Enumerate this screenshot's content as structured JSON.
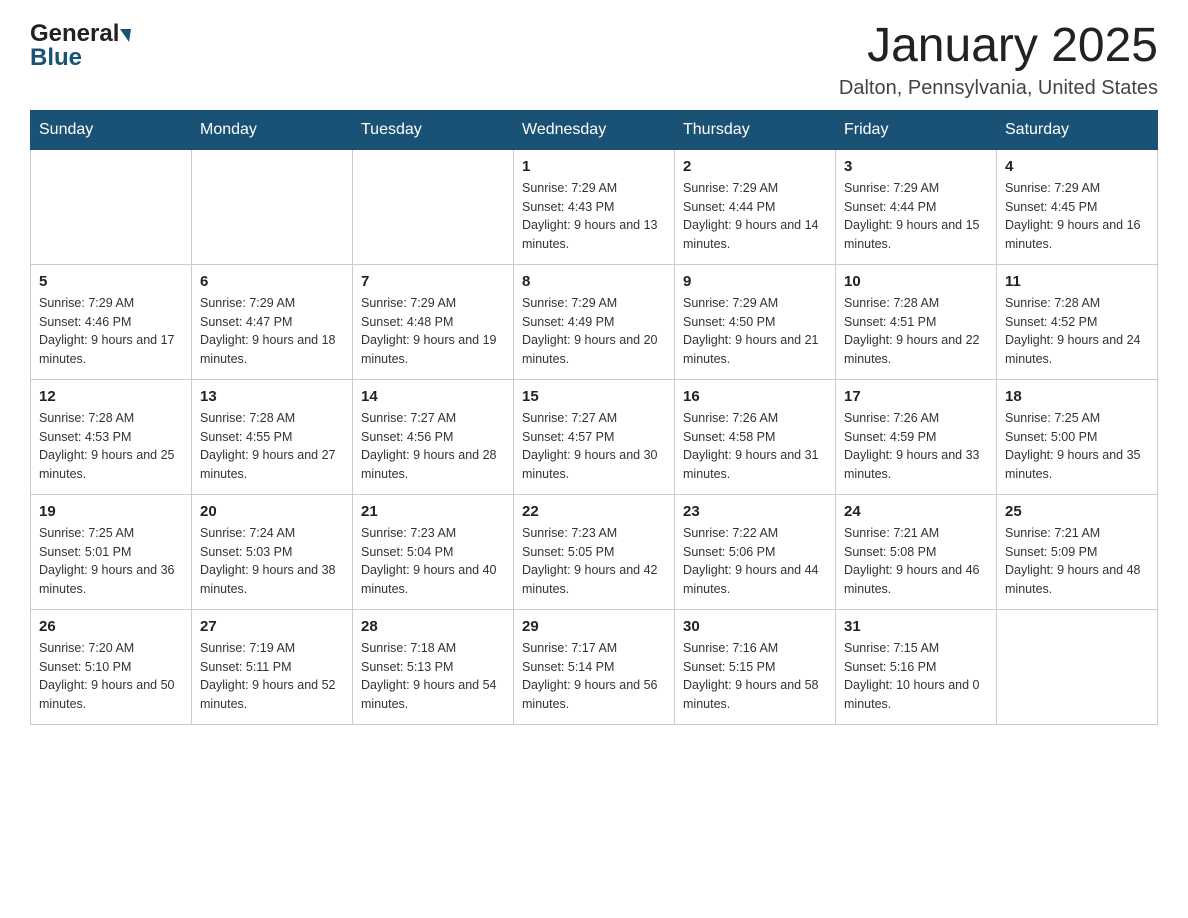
{
  "logo": {
    "general": "General",
    "blue": "Blue"
  },
  "header": {
    "month_year": "January 2025",
    "location": "Dalton, Pennsylvania, United States"
  },
  "days_of_week": [
    "Sunday",
    "Monday",
    "Tuesday",
    "Wednesday",
    "Thursday",
    "Friday",
    "Saturday"
  ],
  "weeks": [
    [
      {
        "day": "",
        "sunrise": "",
        "sunset": "",
        "daylight": ""
      },
      {
        "day": "",
        "sunrise": "",
        "sunset": "",
        "daylight": ""
      },
      {
        "day": "",
        "sunrise": "",
        "sunset": "",
        "daylight": ""
      },
      {
        "day": "1",
        "sunrise": "Sunrise: 7:29 AM",
        "sunset": "Sunset: 4:43 PM",
        "daylight": "Daylight: 9 hours and 13 minutes."
      },
      {
        "day": "2",
        "sunrise": "Sunrise: 7:29 AM",
        "sunset": "Sunset: 4:44 PM",
        "daylight": "Daylight: 9 hours and 14 minutes."
      },
      {
        "day": "3",
        "sunrise": "Sunrise: 7:29 AM",
        "sunset": "Sunset: 4:44 PM",
        "daylight": "Daylight: 9 hours and 15 minutes."
      },
      {
        "day": "4",
        "sunrise": "Sunrise: 7:29 AM",
        "sunset": "Sunset: 4:45 PM",
        "daylight": "Daylight: 9 hours and 16 minutes."
      }
    ],
    [
      {
        "day": "5",
        "sunrise": "Sunrise: 7:29 AM",
        "sunset": "Sunset: 4:46 PM",
        "daylight": "Daylight: 9 hours and 17 minutes."
      },
      {
        "day": "6",
        "sunrise": "Sunrise: 7:29 AM",
        "sunset": "Sunset: 4:47 PM",
        "daylight": "Daylight: 9 hours and 18 minutes."
      },
      {
        "day": "7",
        "sunrise": "Sunrise: 7:29 AM",
        "sunset": "Sunset: 4:48 PM",
        "daylight": "Daylight: 9 hours and 19 minutes."
      },
      {
        "day": "8",
        "sunrise": "Sunrise: 7:29 AM",
        "sunset": "Sunset: 4:49 PM",
        "daylight": "Daylight: 9 hours and 20 minutes."
      },
      {
        "day": "9",
        "sunrise": "Sunrise: 7:29 AM",
        "sunset": "Sunset: 4:50 PM",
        "daylight": "Daylight: 9 hours and 21 minutes."
      },
      {
        "day": "10",
        "sunrise": "Sunrise: 7:28 AM",
        "sunset": "Sunset: 4:51 PM",
        "daylight": "Daylight: 9 hours and 22 minutes."
      },
      {
        "day": "11",
        "sunrise": "Sunrise: 7:28 AM",
        "sunset": "Sunset: 4:52 PM",
        "daylight": "Daylight: 9 hours and 24 minutes."
      }
    ],
    [
      {
        "day": "12",
        "sunrise": "Sunrise: 7:28 AM",
        "sunset": "Sunset: 4:53 PM",
        "daylight": "Daylight: 9 hours and 25 minutes."
      },
      {
        "day": "13",
        "sunrise": "Sunrise: 7:28 AM",
        "sunset": "Sunset: 4:55 PM",
        "daylight": "Daylight: 9 hours and 27 minutes."
      },
      {
        "day": "14",
        "sunrise": "Sunrise: 7:27 AM",
        "sunset": "Sunset: 4:56 PM",
        "daylight": "Daylight: 9 hours and 28 minutes."
      },
      {
        "day": "15",
        "sunrise": "Sunrise: 7:27 AM",
        "sunset": "Sunset: 4:57 PM",
        "daylight": "Daylight: 9 hours and 30 minutes."
      },
      {
        "day": "16",
        "sunrise": "Sunrise: 7:26 AM",
        "sunset": "Sunset: 4:58 PM",
        "daylight": "Daylight: 9 hours and 31 minutes."
      },
      {
        "day": "17",
        "sunrise": "Sunrise: 7:26 AM",
        "sunset": "Sunset: 4:59 PM",
        "daylight": "Daylight: 9 hours and 33 minutes."
      },
      {
        "day": "18",
        "sunrise": "Sunrise: 7:25 AM",
        "sunset": "Sunset: 5:00 PM",
        "daylight": "Daylight: 9 hours and 35 minutes."
      }
    ],
    [
      {
        "day": "19",
        "sunrise": "Sunrise: 7:25 AM",
        "sunset": "Sunset: 5:01 PM",
        "daylight": "Daylight: 9 hours and 36 minutes."
      },
      {
        "day": "20",
        "sunrise": "Sunrise: 7:24 AM",
        "sunset": "Sunset: 5:03 PM",
        "daylight": "Daylight: 9 hours and 38 minutes."
      },
      {
        "day": "21",
        "sunrise": "Sunrise: 7:23 AM",
        "sunset": "Sunset: 5:04 PM",
        "daylight": "Daylight: 9 hours and 40 minutes."
      },
      {
        "day": "22",
        "sunrise": "Sunrise: 7:23 AM",
        "sunset": "Sunset: 5:05 PM",
        "daylight": "Daylight: 9 hours and 42 minutes."
      },
      {
        "day": "23",
        "sunrise": "Sunrise: 7:22 AM",
        "sunset": "Sunset: 5:06 PM",
        "daylight": "Daylight: 9 hours and 44 minutes."
      },
      {
        "day": "24",
        "sunrise": "Sunrise: 7:21 AM",
        "sunset": "Sunset: 5:08 PM",
        "daylight": "Daylight: 9 hours and 46 minutes."
      },
      {
        "day": "25",
        "sunrise": "Sunrise: 7:21 AM",
        "sunset": "Sunset: 5:09 PM",
        "daylight": "Daylight: 9 hours and 48 minutes."
      }
    ],
    [
      {
        "day": "26",
        "sunrise": "Sunrise: 7:20 AM",
        "sunset": "Sunset: 5:10 PM",
        "daylight": "Daylight: 9 hours and 50 minutes."
      },
      {
        "day": "27",
        "sunrise": "Sunrise: 7:19 AM",
        "sunset": "Sunset: 5:11 PM",
        "daylight": "Daylight: 9 hours and 52 minutes."
      },
      {
        "day": "28",
        "sunrise": "Sunrise: 7:18 AM",
        "sunset": "Sunset: 5:13 PM",
        "daylight": "Daylight: 9 hours and 54 minutes."
      },
      {
        "day": "29",
        "sunrise": "Sunrise: 7:17 AM",
        "sunset": "Sunset: 5:14 PM",
        "daylight": "Daylight: 9 hours and 56 minutes."
      },
      {
        "day": "30",
        "sunrise": "Sunrise: 7:16 AM",
        "sunset": "Sunset: 5:15 PM",
        "daylight": "Daylight: 9 hours and 58 minutes."
      },
      {
        "day": "31",
        "sunrise": "Sunrise: 7:15 AM",
        "sunset": "Sunset: 5:16 PM",
        "daylight": "Daylight: 10 hours and 0 minutes."
      },
      {
        "day": "",
        "sunrise": "",
        "sunset": "",
        "daylight": ""
      }
    ]
  ]
}
